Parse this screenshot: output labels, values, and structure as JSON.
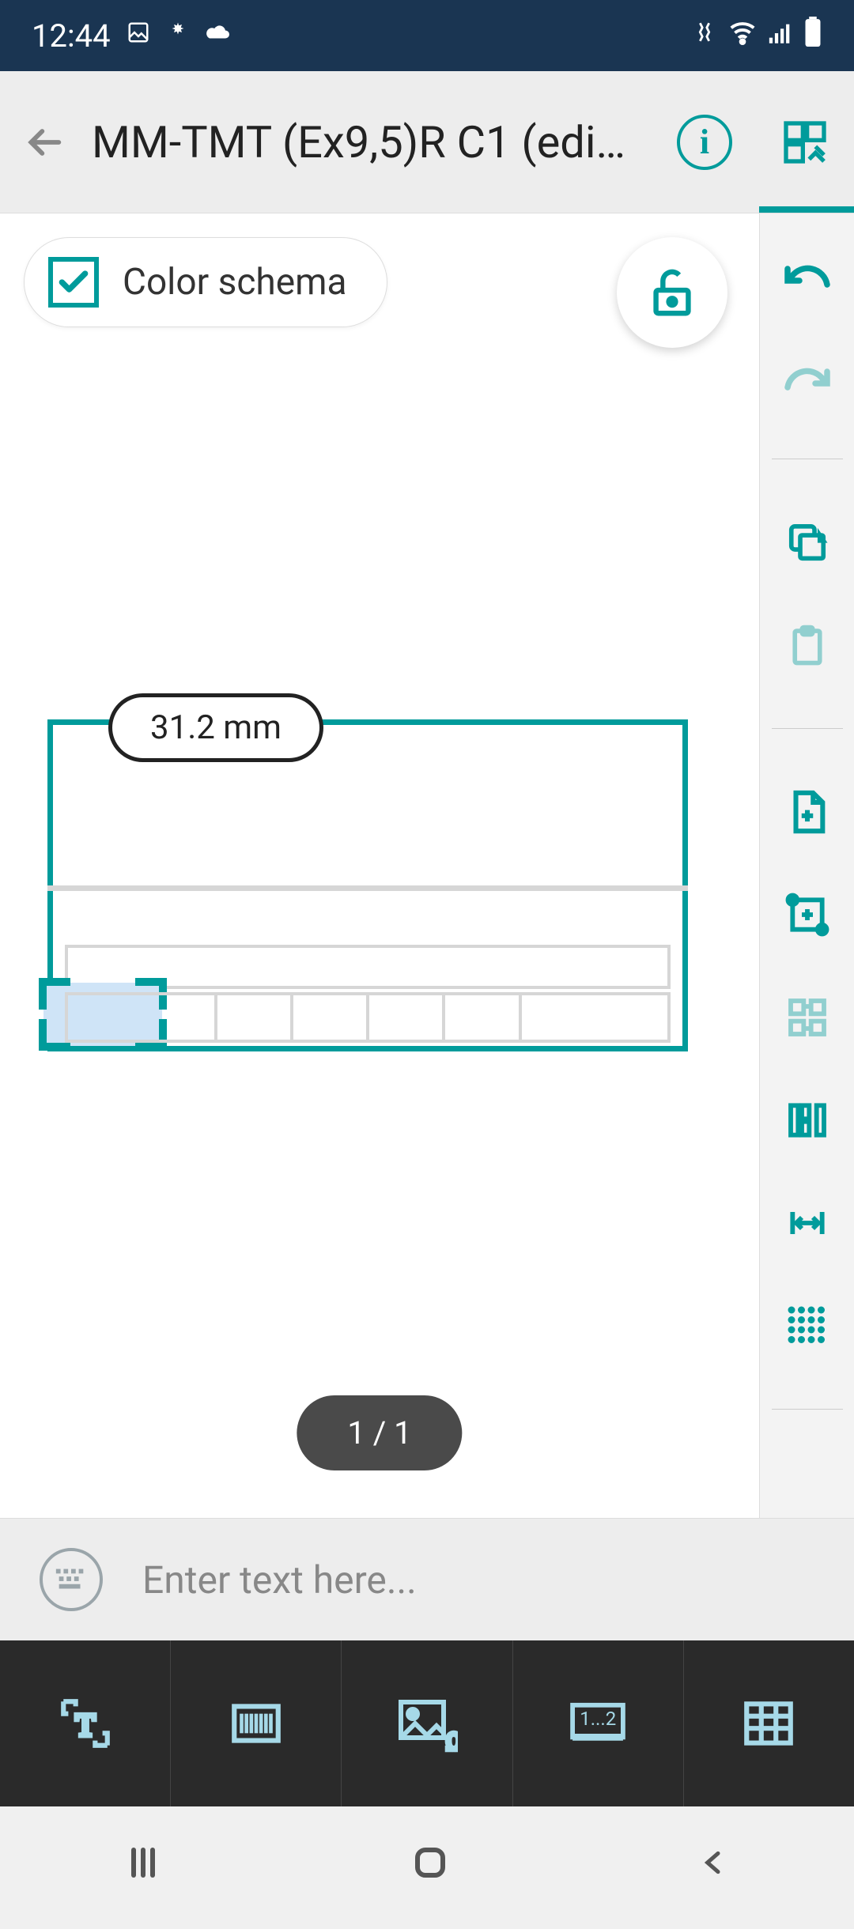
{
  "status": {
    "time": "12:44"
  },
  "header": {
    "title": "MM-TMT (Ex9,5)R C1 (edi…"
  },
  "chip": {
    "label": "Color schema"
  },
  "canvas": {
    "measurement": "31.2 mm",
    "pager": "1 / 1"
  },
  "input": {
    "placeholder": "Enter text here..."
  },
  "bottom_tools": {
    "number_placeholder": "1...2"
  }
}
